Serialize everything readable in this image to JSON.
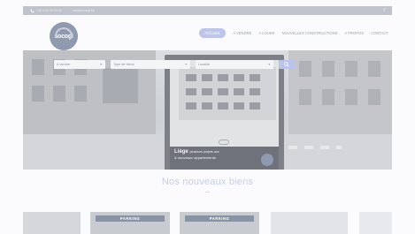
{
  "topbar": {
    "phone": "+32 4 00 00 00 00",
    "email": "info@socogi.be",
    "social_icon": "facebook-icon"
  },
  "logo": {
    "text": "socogi"
  },
  "nav": {
    "items": [
      {
        "label": "ACCUEIL",
        "active": true
      },
      {
        "label": "A VENDRE",
        "active": false
      },
      {
        "label": "A LOUER",
        "active": false
      },
      {
        "label": "NOUVELLES CONSTRUCTIONS",
        "active": false
      },
      {
        "label": "A PROPOS",
        "active": false
      },
      {
        "label": "CONTACT",
        "active": false
      }
    ]
  },
  "search": {
    "transaction": "A vendre",
    "type": "Type de biens",
    "location": "Localité",
    "button_icon": "search-icon"
  },
  "hero_billboard": {
    "line1": "Liège",
    "line1_small": "plusieurs projets aux",
    "line2": "& nouveaux appartements"
  },
  "section": {
    "title": "Nos nouveaux biens"
  },
  "listings": [
    {
      "banner": ""
    },
    {
      "banner": "PARKING"
    },
    {
      "banner": "PARKING"
    },
    {
      "banner": ""
    },
    {
      "banner": ""
    }
  ],
  "colors": {
    "accent": "#bcc6ea",
    "title": "#c6cde8",
    "topbar": "#bfc3cb"
  }
}
